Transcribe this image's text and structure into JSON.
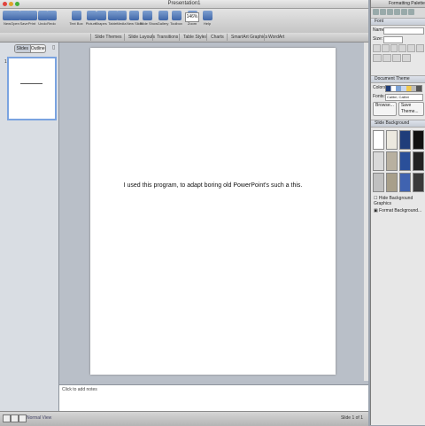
{
  "window": {
    "title": "Presentation1"
  },
  "toolbar": {
    "buttons": [
      {
        "label": "New",
        "icon": "new-icon"
      },
      {
        "label": "Open",
        "icon": "open-icon"
      },
      {
        "label": "Save",
        "icon": "save-icon"
      },
      {
        "label": "Print",
        "icon": "print-icon"
      },
      {
        "label": "Undo",
        "icon": "undo-icon"
      },
      {
        "label": "Redo",
        "icon": "redo-icon"
      },
      {
        "label": "Text Box",
        "icon": "textbox-icon"
      },
      {
        "label": "Picture",
        "icon": "picture-icon"
      },
      {
        "label": "Shapes",
        "icon": "shapes-icon"
      },
      {
        "label": "Table",
        "icon": "table-icon"
      },
      {
        "label": "Media",
        "icon": "media-icon"
      },
      {
        "label": "New Slide",
        "icon": "new-slide-icon"
      },
      {
        "label": "Slide Show",
        "icon": "slideshow-icon"
      },
      {
        "label": "Gallery",
        "icon": "gallery-icon"
      },
      {
        "label": "Toolbox",
        "icon": "toolbox-icon"
      },
      {
        "label": "Zoom",
        "icon": "zoom-icon"
      },
      {
        "label": "Help",
        "icon": "help-icon"
      }
    ],
    "zoom_value": "146%"
  },
  "ribbon": {
    "tabs": [
      "Slide Themes",
      "Slide Layouts",
      "Transitions",
      "Table Styles",
      "Charts",
      "SmartArt Graphics",
      "WordArt"
    ]
  },
  "sidebar": {
    "tab_slides": "Slides",
    "tab_outline": "Outline",
    "slide_number": "1"
  },
  "slide": {
    "text": "I used this program, to adapt boring old PowerPoint's such a this."
  },
  "notes": {
    "placeholder": "Click to add notes"
  },
  "status": {
    "view_label": "Normal View",
    "slide_counter": "Slide 1 of 1"
  },
  "palette": {
    "title": "Formatting Palette",
    "font_section": "Font",
    "name_label": "Name:",
    "size_label": "Size:",
    "theme_section": "Document Theme",
    "colors_label": "Colors:",
    "fonts_label": "Fonts:",
    "fonts_value": "Calibri, Calibri",
    "browse_label": "Browse...",
    "save_theme_label": "Save Theme...",
    "background_section": "Slide Background",
    "background_swatches": [
      "#ffffff",
      "#ece9df",
      "#1f3d7a",
      "#111111",
      "#d9d9d9",
      "#b8b0a0",
      "#2a4f99",
      "#222222",
      "#c0c0c0",
      "#a89f8a",
      "#4063b0",
      "#3a3a3a"
    ],
    "hide_bg_label": "Hide Background Graphics",
    "format_bg_label": "Format Background..."
  }
}
